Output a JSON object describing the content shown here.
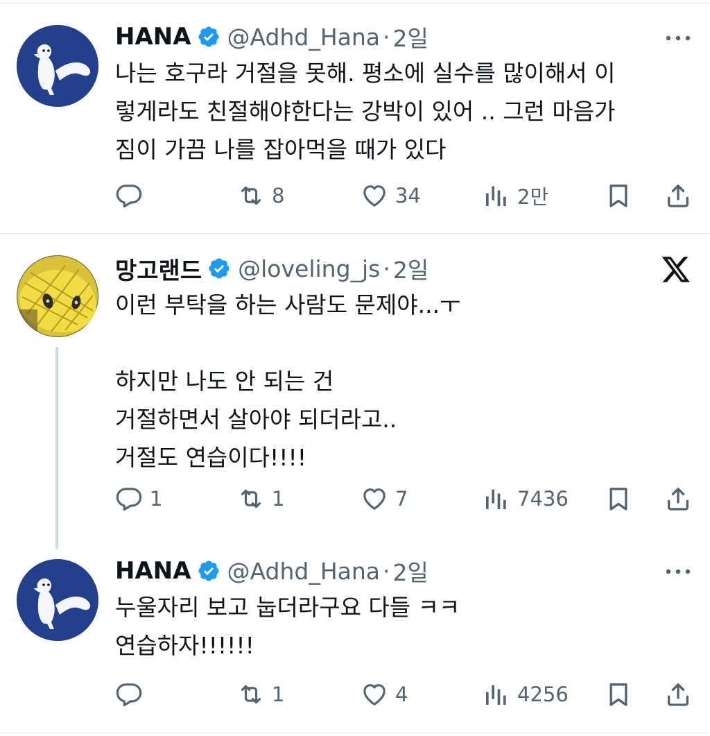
{
  "tweets": [
    {
      "name": "HANA",
      "handle": "@Adhd_Hana",
      "dot": "·",
      "time": "2일",
      "text": "나는 호구라 거절을 못해. 평소에 실수를 많이해서 이\n렇게라도 친절해야한다는 강박이 있어 .. 그런 마음가\n짐이 가끔 나를 잡아먹을 때가 있다",
      "replies": "",
      "retweets": "8",
      "likes": "34",
      "views": "2만"
    },
    {
      "name": "망고랜드",
      "handle": "@loveling_js",
      "dot": "·",
      "time": "2일",
      "text": "이런 부탁을 하는 사람도 문제야...ㅜ\n\n하지만 나도 안 되는 건\n거절하면서 살아야 되더라고..\n거절도 연습이다!!!!",
      "replies": "1",
      "retweets": "1",
      "likes": "7",
      "views": "7436"
    },
    {
      "name": "HANA",
      "handle": "@Adhd_Hana",
      "dot": "·",
      "time": "2일",
      "text": "누울자리 보고 눕더라구요 다들 ㅋㅋ\n연습하자!!!!!!",
      "replies": "",
      "retweets": "1",
      "likes": "4",
      "views": "4256"
    }
  ],
  "icons": {
    "reply": "reply-icon",
    "retweet": "retweet-icon",
    "like": "heart-icon",
    "views": "views-icon",
    "bookmark": "bookmark-icon",
    "share": "share-icon",
    "more": "more-icon",
    "x_logo": "x-logo-icon",
    "verified": "verified-badge-icon"
  },
  "colors": {
    "verified": "#1d9bf0",
    "text": "#0f1419",
    "muted": "#536471",
    "divider": "#e4e7eb"
  }
}
